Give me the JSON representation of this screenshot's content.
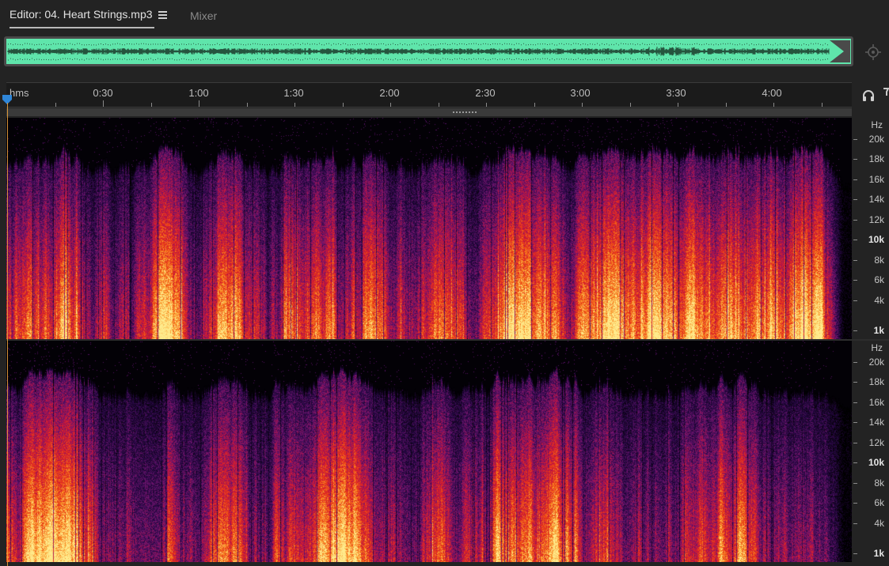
{
  "tabs": {
    "editor_label": "Editor: 04. Heart Strings.mp3",
    "mixer_label": "Mixer"
  },
  "icons": {
    "tab_menu": "hamburger-menu-icon",
    "zoom_navigator": "zoom-navigator-icon",
    "playhead": "playhead-marker-icon",
    "monitor": "headphones-monitor-icon"
  },
  "colors": {
    "overview_wave_bg": "#5fe5ab",
    "playhead": "#e9a03b",
    "playhead_marker": "#2f86d8"
  },
  "ruler": {
    "unit": "hms",
    "labels": [
      "0:30",
      "1:00",
      "1:30",
      "2:00",
      "2:30",
      "3:00",
      "3:30",
      "4:00"
    ]
  },
  "frequency_scale": {
    "unit": "Hz",
    "labels": [
      {
        "text": "20k",
        "bold": false
      },
      {
        "text": "18k",
        "bold": false
      },
      {
        "text": "16k",
        "bold": false
      },
      {
        "text": "14k",
        "bold": false
      },
      {
        "text": "12k",
        "bold": false
      },
      {
        "text": "10k",
        "bold": true
      },
      {
        "text": "8k",
        "bold": false
      },
      {
        "text": "6k",
        "bold": false
      },
      {
        "text": "4k",
        "bold": false
      },
      {
        "text": "1k",
        "bold": true
      }
    ]
  }
}
